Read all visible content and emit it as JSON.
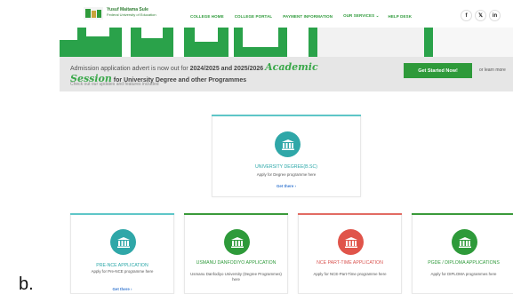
{
  "caption": "b.",
  "header": {
    "logo_title": "Yusuf Maitama Sule",
    "logo_subtitle": "Federal University of Education",
    "nav": [
      "COLLEGE HOME",
      "COLLEGE PORTAL",
      "PAYMENT INFORMATION",
      "OUR SERVICES ⌄",
      "HELP DESK"
    ],
    "social": [
      "f",
      "𝕏",
      "in"
    ]
  },
  "banner": {
    "line1_prefix": "Admission application advert is now out for ",
    "line1_years": "2024/2025 and 2025/2026",
    "line1_academic": "Academic",
    "line2_session": "Session",
    "line2_programmes": " for University Degree and other Programmes",
    "line3": "Check out our updates and features included",
    "cta": "Get Started Now!",
    "learn_more": "or learn more"
  },
  "cards": {
    "degree": {
      "title": "UNIVERSITY DEGREE(B.SC)",
      "desc": "Apply for Degree programme here",
      "go": "Get there ›"
    },
    "prence": {
      "title": "PRE-NCE APPLICATION",
      "desc": "Apply for Pre-NCE programme here",
      "go": "Get there ›"
    },
    "udu": {
      "title": "USMANU DANFODIYO APPLICATION",
      "desc": "Usmanu Danfodiyo University (Degree Programmes) here"
    },
    "nce": {
      "title": "NCE PART-TIME APPLICATION",
      "desc": "Apply for NCE-Part-Time programme here"
    },
    "pgde": {
      "title": "PGDE / DIPLOMA APPLICATIONS",
      "desc": "Apply for DIPLOMA programmes here"
    }
  },
  "colors": {
    "brand_green": "#2e9a3a",
    "teal": "#2fa7a8",
    "red": "#e0544a",
    "banner_bg": "#e6e6e6"
  }
}
